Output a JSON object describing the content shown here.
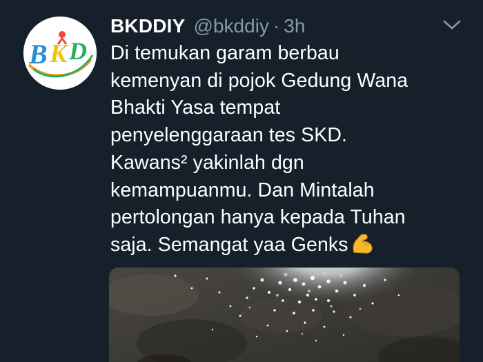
{
  "tweet": {
    "display_name": "BKDDIY",
    "handle": "@bkddiy",
    "separator": "·",
    "time": "3h",
    "avatar_icon": "bkd-logo",
    "caret_icon": "chevron-down-icon",
    "text_lines": [
      "Di temukan garam berbau",
      "kemenyan di pojok Gedung Wana",
      "Bhakti Yasa tempat",
      "penyelenggaraan tes SKD.",
      "Kawans² yakinlah dgn",
      "kemampuanmu. Dan Mintalah",
      "pertolongan hanya kepada Tuhan",
      "saja. Semangat yaa Genks"
    ],
    "emoji": "flexed-biceps",
    "media": "photo of white salt grains on dark ground"
  },
  "colors": {
    "background": "#15202b",
    "secondary_text": "#8899a6",
    "primary_text": "#ffffff"
  }
}
